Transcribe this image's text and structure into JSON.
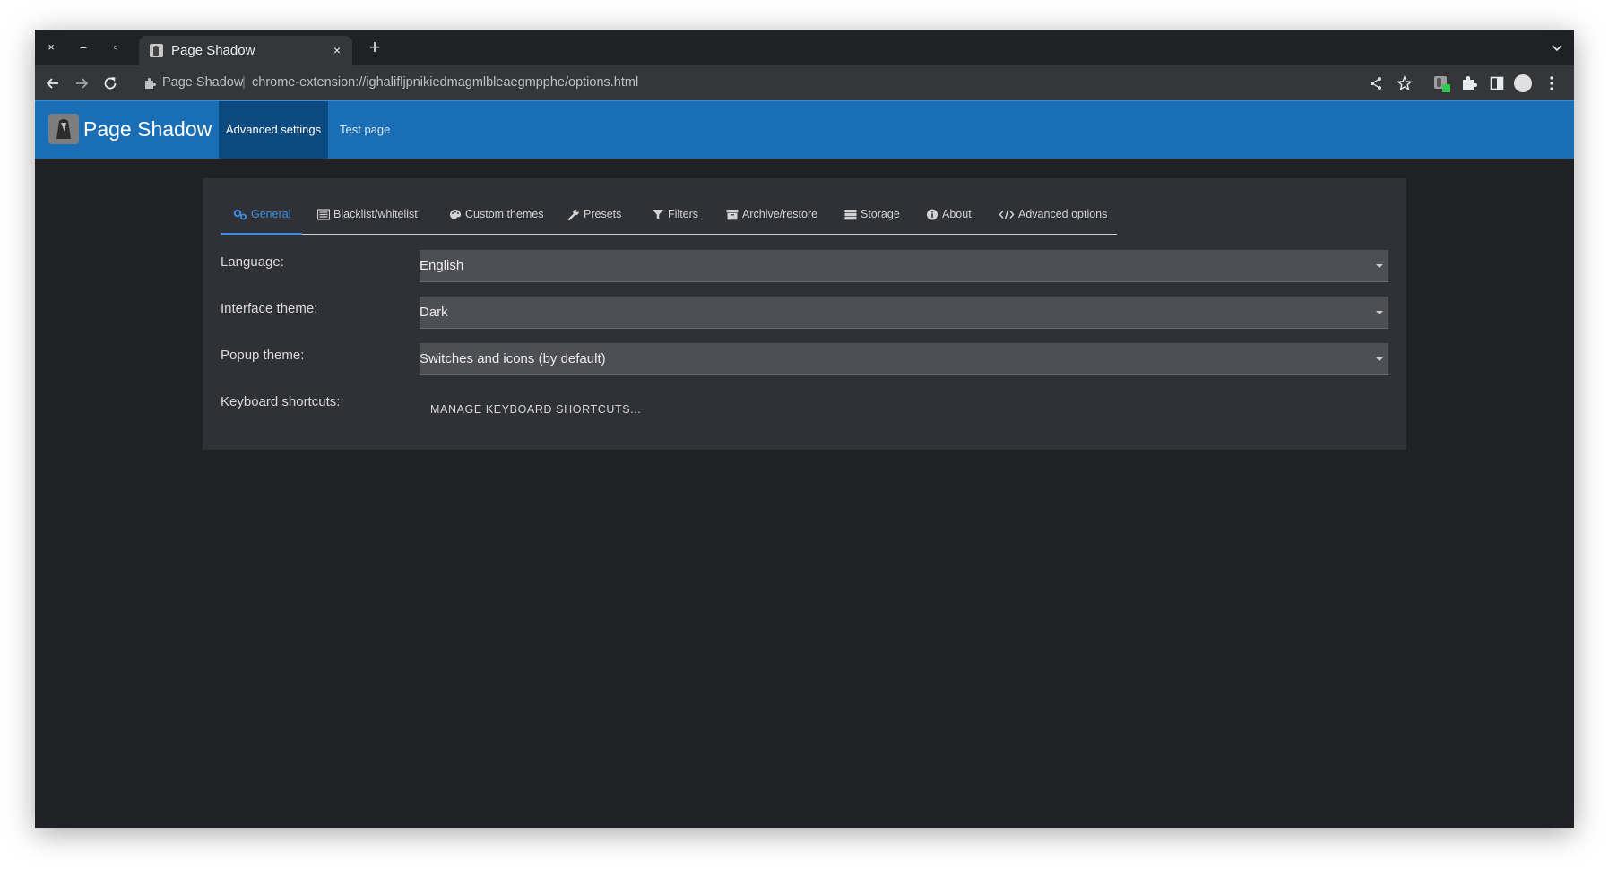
{
  "browser": {
    "tab_title": "Page Shadow",
    "site_name": "Page Shadow",
    "separator": "|",
    "url": "chrome-extension://ighalifljpnikiedmagmlbleaegmpphe/options.html",
    "close_glyph": "×",
    "minimize_glyph": "–",
    "maximize_glyph": "▫",
    "new_tab_glyph": "+"
  },
  "app": {
    "title": "Page Shadow",
    "nav": [
      {
        "label": "Advanced settings",
        "active": true
      },
      {
        "label": "Test page",
        "active": false
      }
    ]
  },
  "settings": {
    "tabs": [
      {
        "label": "General",
        "icon": "gears-icon",
        "active": true
      },
      {
        "label": "Blacklist/whitelist",
        "icon": "list-icon"
      },
      {
        "label": "Custom themes",
        "icon": "palette-icon"
      },
      {
        "label": "Presets",
        "icon": "wrench-icon"
      },
      {
        "label": "Filters",
        "icon": "filter-icon"
      },
      {
        "label": "Archive/restore",
        "icon": "archive-icon"
      },
      {
        "label": "Storage",
        "icon": "storage-icon"
      },
      {
        "label": "About",
        "icon": "info-icon"
      },
      {
        "label": "Advanced options",
        "icon": "code-icon"
      }
    ],
    "language": {
      "label": "Language:",
      "value": "English"
    },
    "interface_theme": {
      "label": "Interface theme:",
      "value": "Dark"
    },
    "popup_theme": {
      "label": "Popup theme:",
      "value": "Switches and icons (by default)"
    },
    "keyboard_shortcuts": {
      "label": "Keyboard shortcuts:",
      "button": "MANAGE KEYBOARD SHORTCUTS..."
    }
  },
  "colors": {
    "header_blue": "#1a6eb5",
    "active_nav": "#0d4a80",
    "accent": "#3d8ee0",
    "background": "#202124",
    "card": "#303136"
  }
}
